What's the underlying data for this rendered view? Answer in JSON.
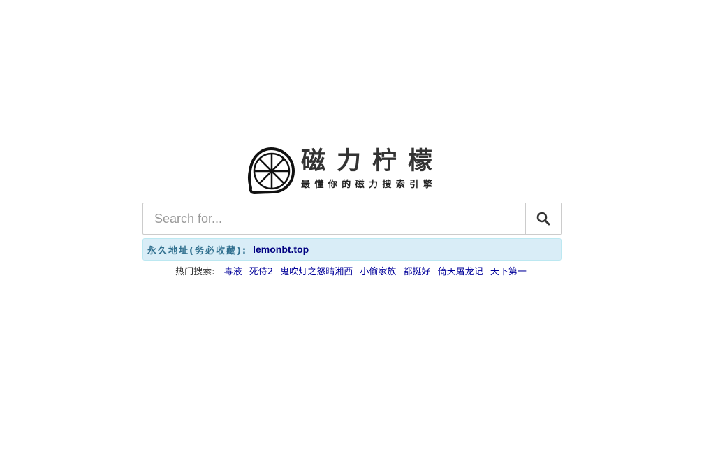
{
  "logo": {
    "title": "磁力柠檬",
    "slogan": "最懂你的磁力搜索引擎"
  },
  "search": {
    "placeholder": "Search for...",
    "value": "",
    "button_icon": "search-icon"
  },
  "notice": {
    "label": "永久地址(务必收藏):",
    "link": "lemonbt.top"
  },
  "hot_searches": {
    "label": "热门搜索:",
    "items": [
      "毒液",
      "死侍2",
      "鬼吹灯之怒晴湘西",
      "小偷家族",
      "都挺好",
      "倚天屠龙记",
      "天下第一"
    ]
  }
}
